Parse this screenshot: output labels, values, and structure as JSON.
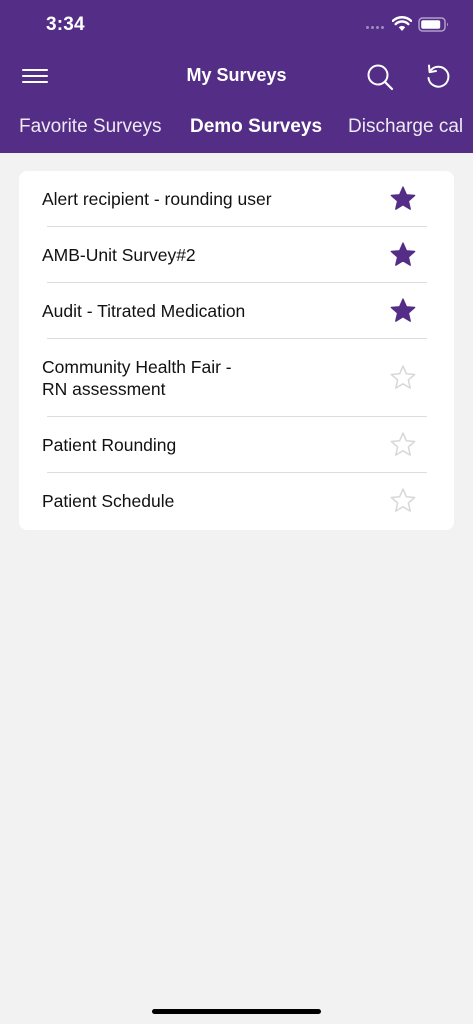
{
  "status_bar": {
    "time": "3:34"
  },
  "header": {
    "title": "My Surveys",
    "menu_icon": "hamburger-menu-icon",
    "search_icon": "search-icon",
    "refresh_icon": "refresh-icon"
  },
  "tabs": [
    {
      "label": "Favorite Surveys",
      "active": false
    },
    {
      "label": "Demo Surveys",
      "active": true
    },
    {
      "label": "Discharge cal",
      "active": false
    }
  ],
  "surveys": [
    {
      "name": "Alert recipient - rounding user",
      "favorite": true
    },
    {
      "name": "AMB-Unit Survey#2",
      "favorite": true
    },
    {
      "name": "Audit - Titrated Medication",
      "favorite": true
    },
    {
      "name": "Community Health Fair -\nRN assessment",
      "favorite": false
    },
    {
      "name": "Patient Rounding",
      "favorite": false
    },
    {
      "name": "Patient Schedule",
      "favorite": false
    }
  ],
  "colors": {
    "brand": "#542d86",
    "background": "#f2f2f2",
    "star_filled": "#542d86",
    "star_empty": "#d8d8d8"
  }
}
